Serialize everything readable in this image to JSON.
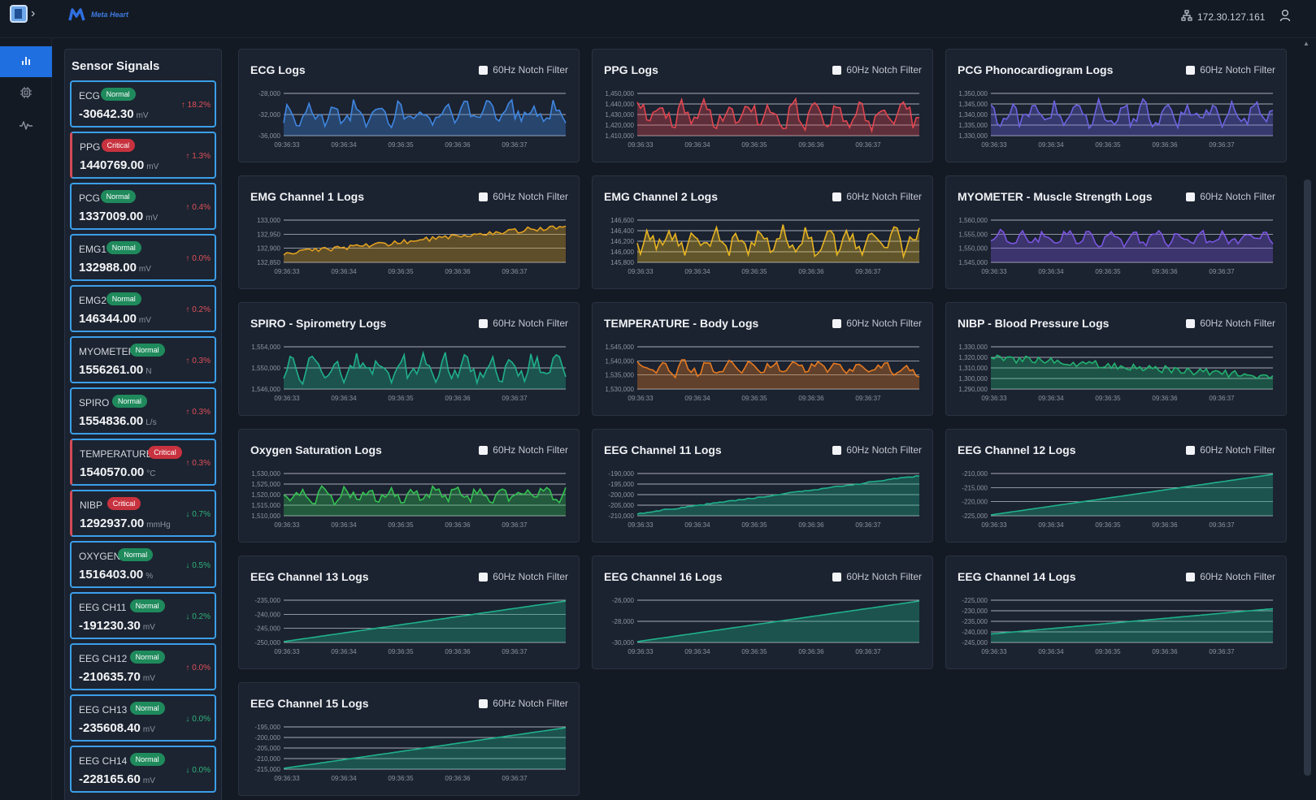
{
  "header": {
    "brand_name": "Meta Heart",
    "ip_address": "172.30.127.161"
  },
  "nav": {
    "items": [
      {
        "icon": "bar-chart-icon",
        "active": true
      },
      {
        "icon": "chip-icon",
        "active": false
      },
      {
        "icon": "pulse-icon",
        "active": false
      }
    ]
  },
  "sensor_panel": {
    "title": "Sensor Signals",
    "signals": [
      {
        "name": "ECG",
        "status": "Normal",
        "value": "-30642.30",
        "unit": "mV",
        "delta": "18.2%",
        "direction": "up"
      },
      {
        "name": "PPG",
        "status": "Critical",
        "value": "1440769.00",
        "unit": "mV",
        "delta": "1.3%",
        "direction": "up"
      },
      {
        "name": "PCG",
        "status": "Normal",
        "value": "1337009.00",
        "unit": "mV",
        "delta": "0.4%",
        "direction": "up"
      },
      {
        "name": "EMG1",
        "status": "Normal",
        "value": "132988.00",
        "unit": "mV",
        "delta": "0.0%",
        "direction": "up"
      },
      {
        "name": "EMG2",
        "status": "Normal",
        "value": "146344.00",
        "unit": "mV",
        "delta": "0.2%",
        "direction": "up"
      },
      {
        "name": "MYOMETER",
        "status": "Normal",
        "value": "1556261.00",
        "unit": "N",
        "delta": "0.3%",
        "direction": "up"
      },
      {
        "name": "SPIRO",
        "status": "Normal",
        "value": "1554836.00",
        "unit": "L/s",
        "delta": "0.3%",
        "direction": "up"
      },
      {
        "name": "TEMPERATURE",
        "status": "Critical",
        "value": "1540570.00",
        "unit": "°C",
        "delta": "0.3%",
        "direction": "up"
      },
      {
        "name": "NIBP",
        "status": "Critical",
        "value": "1292937.00",
        "unit": "mmHg",
        "delta": "0.7%",
        "direction": "down"
      },
      {
        "name": "OXYGEN",
        "status": "Normal",
        "value": "1516403.00",
        "unit": "%",
        "delta": "0.5%",
        "direction": "down"
      },
      {
        "name": "EEG CH11",
        "status": "Normal",
        "value": "-191230.30",
        "unit": "mV",
        "delta": "0.2%",
        "direction": "down"
      },
      {
        "name": "EEG CH12",
        "status": "Normal",
        "value": "-210635.70",
        "unit": "mV",
        "delta": "0.0%",
        "direction": "up"
      },
      {
        "name": "EEG CH13",
        "status": "Normal",
        "value": "-235608.40",
        "unit": "mV",
        "delta": "0.0%",
        "direction": "down"
      },
      {
        "name": "EEG CH14",
        "status": "Normal",
        "value": "-228165.60",
        "unit": "mV",
        "delta": "0.0%",
        "direction": "down"
      }
    ]
  },
  "colors": {
    "accent": "#1f6fe0",
    "normal": "#1f8a5c",
    "critical": "#c8323f",
    "card_border": "#3b9ee8"
  },
  "charts": {
    "filter_label": "60Hz Notch Filter",
    "x_ticks": [
      "09:36:33",
      "09:36:34",
      "09:36:35",
      "09:36:36",
      "09:36:37"
    ],
    "panels": [
      {
        "title": "ECG Logs",
        "color": "#3f86e0",
        "style": "wave",
        "y_ticks": [
          "-28,000",
          "-32,000",
          "-36,000"
        ]
      },
      {
        "title": "PPG Logs",
        "color": "#e0464f",
        "style": "wave",
        "y_ticks": [
          "1,450,000",
          "1,440,000",
          "1,430,000",
          "1,420,000",
          "1,410,000"
        ]
      },
      {
        "title": "PCG Phonocardiogram Logs",
        "color": "#6b63e0",
        "style": "wave",
        "y_ticks": [
          "1,350,000",
          "1,345,000",
          "1,340,000",
          "1,335,000",
          "1,330,000"
        ]
      },
      {
        "title": "EMG Channel 1 Logs",
        "color": "#e0a020",
        "style": "trend",
        "y_ticks": [
          "133,000",
          "132,950",
          "132,900",
          "132,850"
        ]
      },
      {
        "title": "EMG Channel 2 Logs",
        "color": "#e6b422",
        "style": "wave",
        "y_ticks": [
          "146,600",
          "146,400",
          "146,200",
          "146,000",
          "145,800"
        ]
      },
      {
        "title": "MYOMETER - Muscle Strength Logs",
        "color": "#7a55e0",
        "style": "wave-low",
        "y_ticks": [
          "1,560,000",
          "1,555,000",
          "1,550,000",
          "1,545,000"
        ]
      },
      {
        "title": "SPIRO - Spirometry Logs",
        "color": "#20b08a",
        "style": "wave",
        "y_ticks": [
          "1,554,000",
          "1,550,000",
          "1,546,000"
        ]
      },
      {
        "title": "TEMPERATURE - Body Logs",
        "color": "#e57a22",
        "style": "wave-mid",
        "y_ticks": [
          "1,545,000",
          "1,540,000",
          "1,535,000",
          "1,530,000"
        ]
      },
      {
        "title": "NIBP - Blood Pressure Logs",
        "color": "#22b070",
        "style": "decay",
        "y_ticks": [
          "1,330,000",
          "1,320,000",
          "1,310,000",
          "1,300,000",
          "1,290,000"
        ]
      },
      {
        "title": "Oxygen Saturation Logs",
        "color": "#35c052",
        "style": "wave-mid",
        "y_ticks": [
          "1,530,000",
          "1,525,000",
          "1,520,000",
          "1,515,000",
          "1,510,000"
        ]
      },
      {
        "title": "EEG Channel 11 Logs",
        "color": "#20b08a",
        "style": "ramp-noisy",
        "y_ticks": [
          "-190,000",
          "-195,000",
          "-200,000",
          "-205,000",
          "-210,000"
        ]
      },
      {
        "title": "EEG Channel 12 Logs",
        "color": "#20b08a",
        "style": "ramp",
        "y_ticks": [
          "-210,000",
          "-215,000",
          "-220,000",
          "-225,000"
        ]
      },
      {
        "title": "EEG Channel 13 Logs",
        "color": "#20b08a",
        "style": "ramp",
        "y_ticks": [
          "-235,000",
          "-240,000",
          "-245,000",
          "-250,000"
        ]
      },
      {
        "title": "EEG Channel 16 Logs",
        "color": "#20b08a",
        "style": "ramp",
        "y_ticks": [
          "-26,000",
          "-28,000",
          "-30,000"
        ]
      },
      {
        "title": "EEG Channel 14 Logs",
        "color": "#20b08a",
        "style": "ramp-mid",
        "y_ticks": [
          "-225,000",
          "-230,000",
          "-235,000",
          "-240,000",
          "-245,000"
        ]
      },
      {
        "title": "EEG Channel 15 Logs",
        "color": "#20b08a",
        "style": "ramp",
        "y_ticks": [
          "-195,000",
          "-200,000",
          "-205,000",
          "-210,000",
          "-215,000"
        ]
      }
    ]
  }
}
